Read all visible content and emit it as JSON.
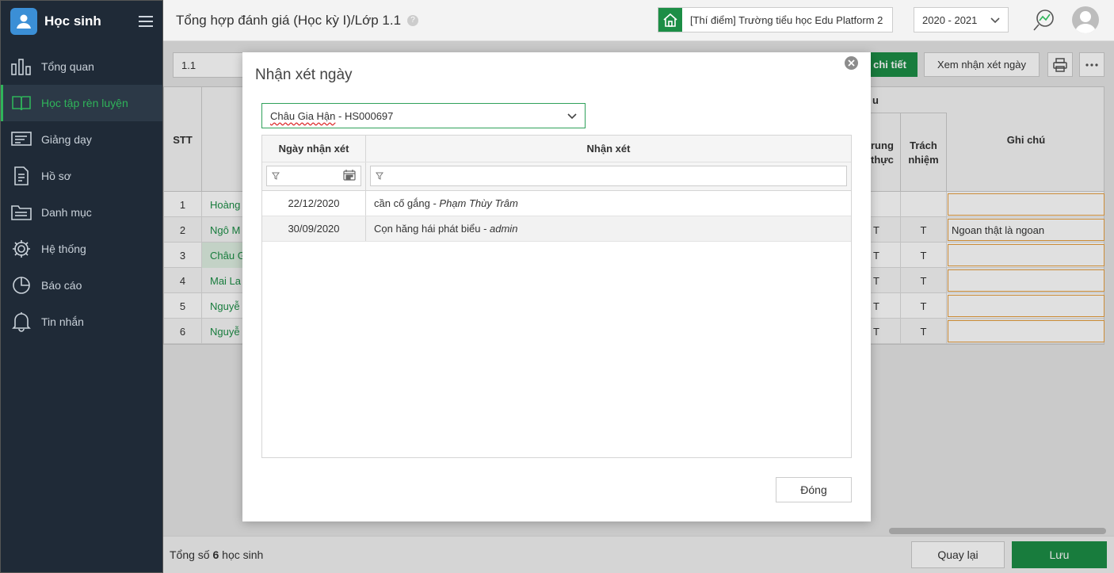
{
  "app": {
    "title": "Học sinh"
  },
  "sidebar": {
    "items": [
      {
        "label": "Tổng quan",
        "icon": "bar-chart-icon"
      },
      {
        "label": "Học tập rèn luyện",
        "icon": "book-icon",
        "active": true
      },
      {
        "label": "Giảng dạy",
        "icon": "board-icon"
      },
      {
        "label": "Hồ sơ",
        "icon": "document-icon"
      },
      {
        "label": "Danh mục",
        "icon": "folder-icon"
      },
      {
        "label": "Hệ thống",
        "icon": "gear-icon"
      },
      {
        "label": "Báo cáo",
        "icon": "pie-chart-icon"
      },
      {
        "label": "Tin nhắn",
        "icon": "bell-icon"
      }
    ]
  },
  "header": {
    "title": "Tổng hợp đánh giá (Học kỳ I)/Lớp 1.1",
    "help": "?",
    "school": "[Thí điểm] Trường tiểu học Edu Platform 2",
    "year": "2020 - 2021"
  },
  "toolbar": {
    "class_value": "1.1",
    "detail_label": "chi tiết",
    "view_daily_label": "Xem nhận xét ngày"
  },
  "grid": {
    "col_stt": "STT",
    "col_group_partial": "u",
    "col_trung_line1": "rung",
    "col_trung_line2": "thực",
    "col_trach_line1": "Trách",
    "col_trach_line2": "nhiệm",
    "col_note": "Ghi chú",
    "rows": [
      {
        "stt": "1",
        "name": "Hoàng",
        "t1": "",
        "t2": "",
        "note": ""
      },
      {
        "stt": "2",
        "name": "Ngô M",
        "t1": "T",
        "t2": "T",
        "note": "Ngoan thật là ngoan"
      },
      {
        "stt": "3",
        "name": "Châu G",
        "t1": "T",
        "t2": "T",
        "note": ""
      },
      {
        "stt": "4",
        "name": "Mai La",
        "t1": "T",
        "t2": "T",
        "note": ""
      },
      {
        "stt": "5",
        "name": "Nguyễ",
        "t1": "T",
        "t2": "T",
        "note": ""
      },
      {
        "stt": "6",
        "name": "Nguyễ",
        "t1": "T",
        "t2": "T",
        "note": ""
      }
    ]
  },
  "footer": {
    "total_prefix": "Tổng số ",
    "total_count": "6",
    "total_suffix": " học sinh",
    "back_label": "Quay lại",
    "save_label": "Lưu"
  },
  "modal": {
    "title": "Nhận xét ngày",
    "student_name": "Châu Gia Hận",
    "student_code": " - HS000697",
    "col_date": "Ngày nhận xét",
    "col_comment": "Nhận xét",
    "rows": [
      {
        "date": "22/12/2020",
        "comment": "cần cố gắng",
        "author": "Phạm Thùy Trâm"
      },
      {
        "date": "30/09/2020",
        "comment": "Cọn hăng hái phát biểu",
        "author": "admin"
      }
    ],
    "close_label": "Đóng"
  },
  "colors": {
    "accent": "#1c8e46",
    "sidebar_bg": "#1f2a37",
    "active_text": "#2fb45a",
    "note_border": "#e8a040"
  }
}
